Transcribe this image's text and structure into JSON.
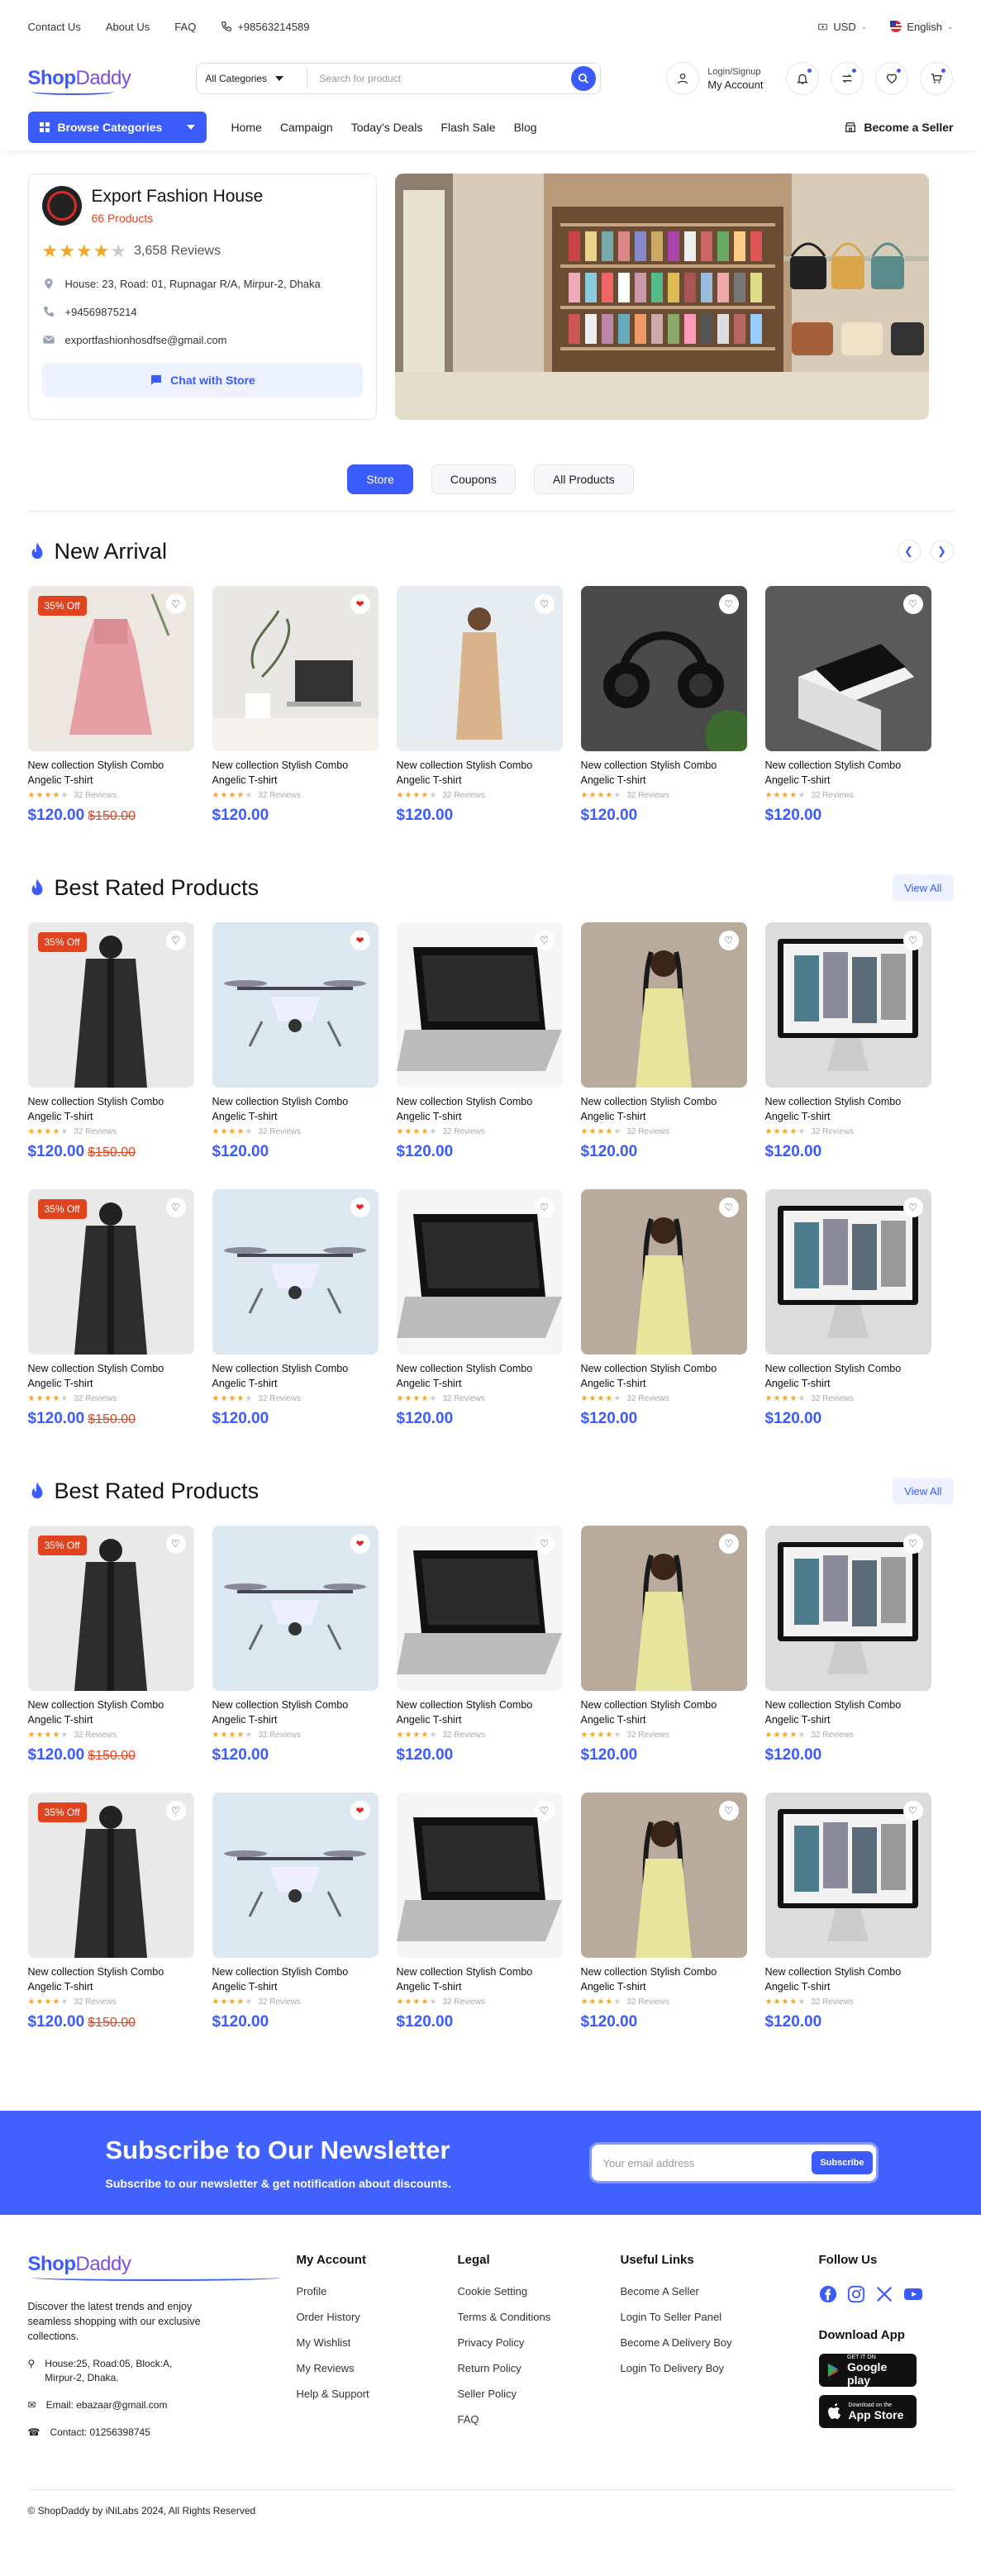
{
  "topbar": {
    "contact": "Contact Us",
    "about": "About Us",
    "faq": "FAQ",
    "phone": "+98563214589",
    "currency": "USD",
    "language": "English"
  },
  "header": {
    "logo_a": "Shop",
    "logo_b": "Daddy",
    "category": "All Categories",
    "search_placeholder": "Search for product",
    "login": "Login/Signup",
    "account": "My Account"
  },
  "nav": {
    "browse": "Browse Categories",
    "items": [
      "Home",
      "Campaign",
      "Today's Deals",
      "Flash Sale",
      "Blog"
    ],
    "become_seller": "Become a Seller"
  },
  "store": {
    "name": "Export Fashion House",
    "products": "66 Products",
    "rating": 4,
    "reviews": "3,658 Reviews",
    "address": "House: 23, Road: 01, Rupnagar R/A, Mirpur-2, Dhaka",
    "phone": "+94569875214",
    "email": "exportfashionhosdfse@gmail.com",
    "chat": "Chat with Store"
  },
  "tabs": [
    "Store",
    "Coupons",
    "All Products"
  ],
  "sections": {
    "new_arrival": "New Arrival",
    "best_rated": "Best Rated Products",
    "view_all": "View All"
  },
  "product": {
    "name": "New collection Stylish Combo Angelic T-shirt",
    "reviews": "32 Reviews",
    "price": "$120.00",
    "old_price": "$150.00",
    "discount": "35% Off",
    "rating": 4
  },
  "newsletter": {
    "title": "Subscribe to Our Newsletter",
    "subtitle": "Subscribe to our newsletter & get notification about discounts.",
    "placeholder": "Your email address",
    "button": "Subscribe"
  },
  "footer": {
    "desc": "Discover the latest trends and enjoy seamless shopping with our exclusive collections.",
    "address": "House:25, Road:05, Block:A, Mirpur-2, Dhaka.",
    "email": "Email: ebazaar@gmail.com",
    "contact": "Contact: 01256398745",
    "my_account": {
      "title": "My Account",
      "links": [
        "Profile",
        "Order History",
        "My Wishlist",
        "My Reviews",
        "Help & Support"
      ]
    },
    "legal": {
      "title": "Legal",
      "links": [
        "Cookie Setting",
        "Terms & Conditions",
        "Privacy Policy",
        "Return Policy",
        "Seller Policy",
        "FAQ"
      ]
    },
    "useful": {
      "title": "Useful Links",
      "links": [
        "Become A Seller",
        "Login To Seller Panel",
        "Become A Delivery Boy",
        "Login To Delivery Boy"
      ]
    },
    "follow": "Follow Us",
    "download": "Download App",
    "gp_small": "GET IT ON",
    "gp": "Google play",
    "as_small": "Download on the",
    "as": "App Store",
    "copyright": "© ShopDaddy by iNiLabs 2024, All Rights Reserved"
  },
  "colors": {
    "accent": "#3b5bfd",
    "sale": "#e0441f",
    "star": "#f5a623"
  }
}
